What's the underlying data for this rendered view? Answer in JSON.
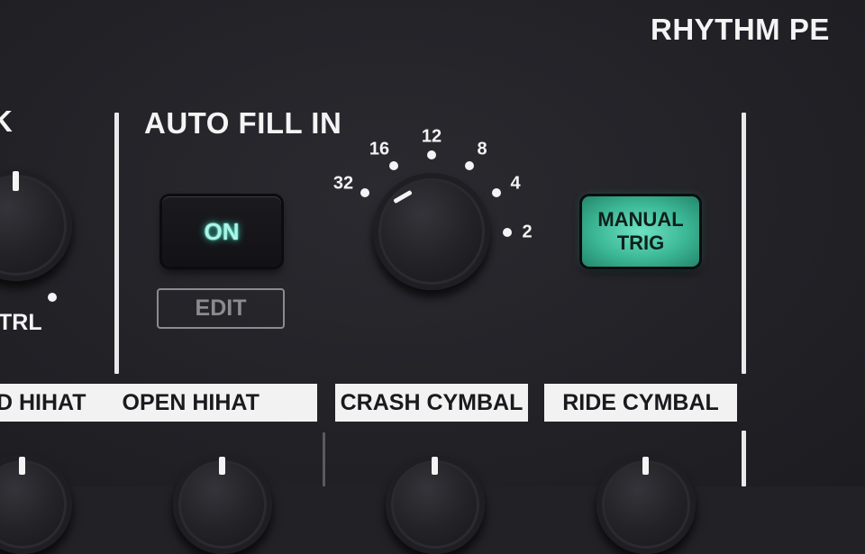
{
  "panel": {
    "section_title": "RHYTHM PE",
    "ctrl_label": "TRL",
    "left_label": "K"
  },
  "auto_fill_in": {
    "title": "AUTO FILL IN",
    "on_button": "ON",
    "edit_label": "EDIT",
    "knob_scale": [
      "32",
      "16",
      "12",
      "8",
      "4",
      "2"
    ],
    "knob_value": "16",
    "manual_trig": [
      "MANUAL",
      "TRIG"
    ]
  },
  "instrument_tags": {
    "closed_hihat": "D HIHAT",
    "open_hihat": "OPEN HIHAT",
    "crash_cymbal": "CRASH CYMBAL",
    "ride_cymbal": "RIDE CYMBAL"
  },
  "colors": {
    "panel": "#212126",
    "led_teal": "#3cb896",
    "text": "#f4f4f4"
  }
}
